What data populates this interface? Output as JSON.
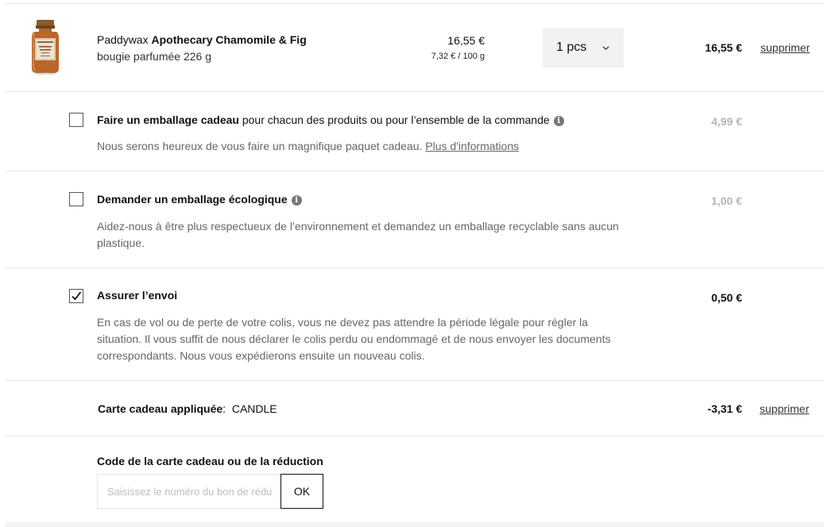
{
  "product": {
    "brand": "Paddywax",
    "name": "Apothecary Chamomile & Fig",
    "subtitle": "bougie parfumée 226 g",
    "unit_price": "16,55 €",
    "price_per_100g": "7,32 € / 100 g",
    "quantity": "1 pcs",
    "line_total": "16,55 €",
    "remove_label": "supprimer",
    "image_icon": "candle-jar-image"
  },
  "gift_wrap": {
    "checked": false,
    "title_bold": "Faire un emballage cadeau",
    "title_rest": " pour chacun des produits ou pour l’ensemble de la commande",
    "description": "Nous serons heureux de vous faire un magnifique paquet cadeau. ",
    "more_link": "Plus d'informations",
    "price": "4,99 €",
    "info_icon": "info-icon"
  },
  "eco_packaging": {
    "checked": false,
    "title": "Demander un emballage écologique",
    "description": "Aidez-nous à être plus respectueux de l’environnement et demandez un emballage recyclable sans aucun plastique.",
    "price": "1,00 €",
    "info_icon": "info-icon"
  },
  "shipping_insurance": {
    "checked": true,
    "title": "Assurer l’envoi",
    "description": "En cas de vol ou de perte de votre colis, vous ne devez pas attendre la période légale pour régler la situation. Il vous suffit de nous déclarer le colis perdu ou endommagé et de nous envoyer les documents correspondants. Nous vous expédierons ensuite un nouveau colis.",
    "price": "0,50 €"
  },
  "gift_card": {
    "label": "Carte cadeau appliquée",
    "separator": ":  ",
    "code": "CANDLE",
    "amount": "-3,31 €",
    "remove_label": "supprimer"
  },
  "discount_code": {
    "title": "Code de la carte cadeau ou de la réduction",
    "placeholder": "Saisissez le numéro du bon de réduction",
    "value": "",
    "submit_label": "OK"
  },
  "colors": {
    "divider": "#e6e6e6",
    "muted_price": "#b5b5b5",
    "qty_background": "#f2f2f2",
    "description_text": "#666666"
  }
}
